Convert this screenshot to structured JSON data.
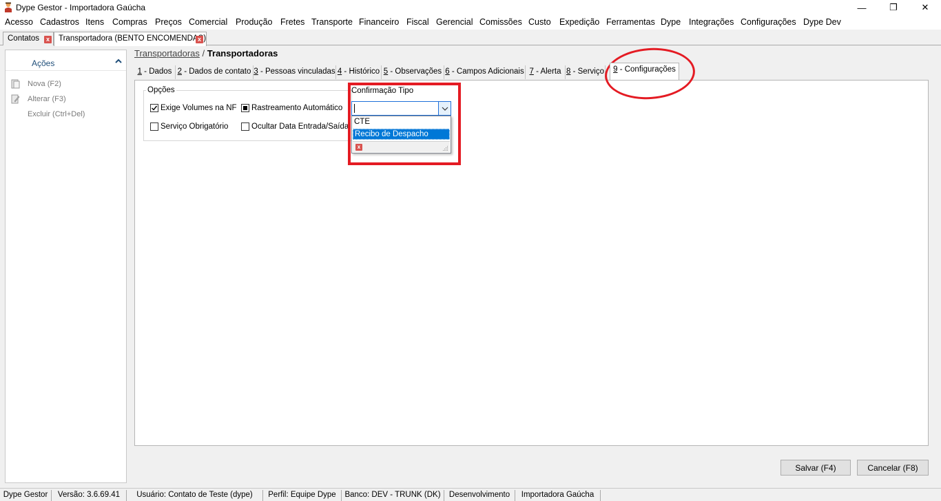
{
  "window": {
    "title": "Dype Gestor - Importadora Gaúcha",
    "minimize": "—",
    "restore": "❐",
    "close": "✕"
  },
  "menu": [
    "Acesso",
    "Cadastros",
    "Itens",
    "Compras",
    "Preços",
    "Comercial",
    "Produção",
    "Fretes",
    "Transporte",
    "Financeiro",
    "Fiscal",
    "Gerencial",
    "Comissões",
    "Custo",
    "Expedição",
    "Ferramentas",
    "Dype",
    "Integrações",
    "Configurações",
    "Dype Dev"
  ],
  "doc_tabs": [
    {
      "label": "Contatos",
      "close": "x"
    },
    {
      "label": "Transportadora (BENTO ENCOMENDAS)",
      "close": "x",
      "active": true
    }
  ],
  "sidebar": {
    "title": "Ações",
    "items": [
      "Nova (F2)",
      "Alterar (F3)",
      "Excluir (Ctrl+Del)"
    ]
  },
  "breadcrumb": {
    "parent": "Transportadoras",
    "separator": "/",
    "current": "Transportadoras"
  },
  "tabs": [
    {
      "num": "1",
      "label": " - Dados"
    },
    {
      "num": "2",
      "label": " - Dados de contato"
    },
    {
      "num": "3",
      "label": " - Pessoas vinculadas"
    },
    {
      "num": "4",
      "label": " - Histórico"
    },
    {
      "num": "5",
      "label": " - Observações"
    },
    {
      "num": "6",
      "label": " - Campos Adicionais"
    },
    {
      "num": "7",
      "label": " - Alerta"
    },
    {
      "num": "8",
      "label": " - Serviço"
    },
    {
      "num": "9",
      "label": " - Configurações",
      "active": true
    }
  ],
  "options": {
    "title": "Opções",
    "exige_volumes": {
      "label": "Exige Volumes na NF",
      "checked": true
    },
    "rastreamento": {
      "label": "Rastreamento Automático",
      "state": "indeterminate"
    },
    "servico_obrigatorio": {
      "label": "Serviço Obrigatório",
      "checked": false
    },
    "ocultar_data": {
      "label": "Ocultar Data Entrada/Saída",
      "checked": false
    }
  },
  "confirmacao": {
    "label": "Confirmação Tipo",
    "value": "",
    "options": [
      "CTE",
      "Recibo de Despacho"
    ],
    "selected_index": 1,
    "clear_icon": "x"
  },
  "buttons": {
    "save": "Salvar (F4)",
    "cancel": "Cancelar (F8)"
  },
  "status": [
    "Dype Gestor",
    "Versão: 3.6.69.41",
    "Usuário: Contato de Teste (dype)",
    "Perfil: Equipe Dype",
    "Banco: DEV - TRUNK (DK)",
    "Desenvolvimento",
    "Importadora Gaúcha"
  ],
  "colors": {
    "annotation_red": "#e41b23",
    "selection_blue": "#0078d7",
    "sidebar_title": "#1f4e79"
  }
}
